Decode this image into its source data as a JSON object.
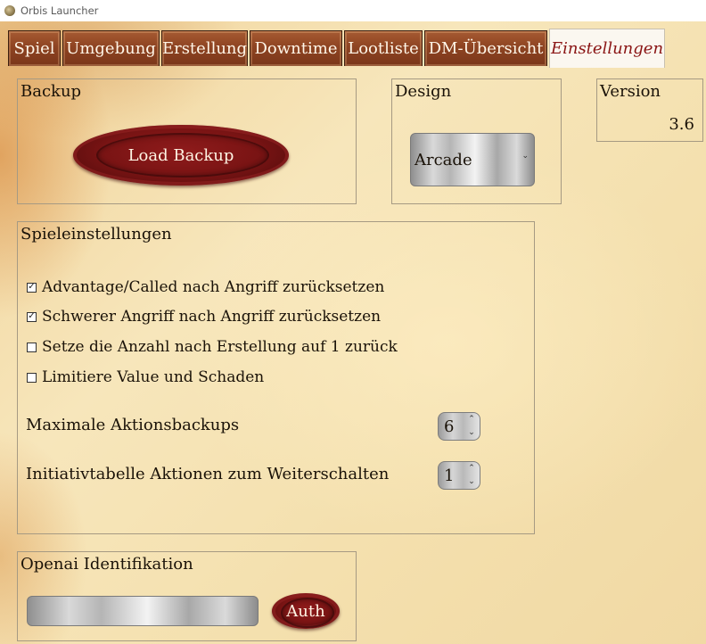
{
  "window": {
    "title": "Orbis Launcher",
    "icon": "orbis-app-icon"
  },
  "tabs": [
    {
      "label": "Spiel",
      "active": false
    },
    {
      "label": "Umgebung",
      "active": false
    },
    {
      "label": "Erstellung",
      "active": false
    },
    {
      "label": "Downtime",
      "active": false
    },
    {
      "label": "Lootliste",
      "active": false
    },
    {
      "label": "DM-Übersicht",
      "active": false
    },
    {
      "label": "Einstellungen",
      "active": true
    }
  ],
  "backup": {
    "title": "Backup",
    "button_label": "Load Backup"
  },
  "design": {
    "title": "Design",
    "selected": "Arcade"
  },
  "version": {
    "title": "Version",
    "value": "3.6"
  },
  "game_settings": {
    "title": "Spieleinstellungen",
    "checkboxes": [
      {
        "label": "Advantage/Called nach Angriff zurücksetzen",
        "checked": true
      },
      {
        "label": "Schwerer Angriff nach Angriff zurücksetzen",
        "checked": true
      },
      {
        "label": "Setze die Anzahl nach Erstellung auf 1 zurück",
        "checked": false
      },
      {
        "label": "Limitiere Value und Schaden",
        "checked": false
      }
    ],
    "max_backups": {
      "label": "Maximale Aktionsbackups",
      "value": "6"
    },
    "initiative": {
      "label": "Initiativtabelle Aktionen zum Weiterschalten",
      "value": "1"
    }
  },
  "openai": {
    "title": "Openai Identifikation",
    "input_value": "",
    "button_label": "Auth"
  },
  "colors": {
    "tab": "#8e4422",
    "seal": "#7a1414",
    "active_tab_text": "#8a1414",
    "panel_border": "#a69a83"
  }
}
